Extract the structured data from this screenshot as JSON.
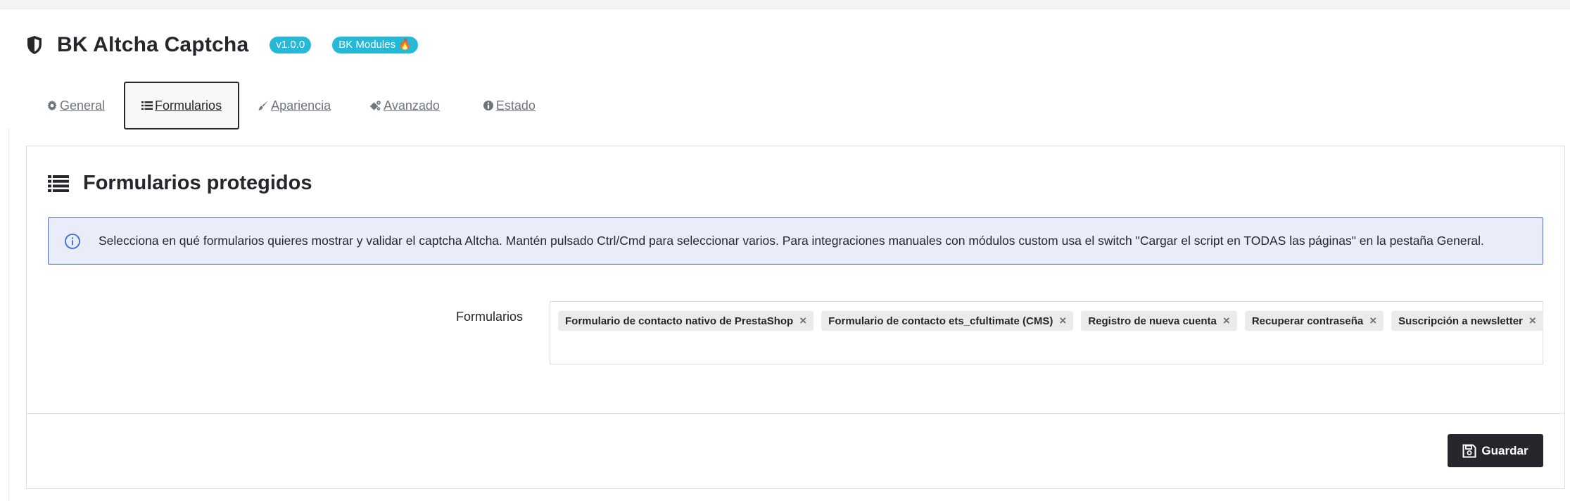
{
  "header": {
    "icon": "shield-icon",
    "title": "BK Altcha Captcha",
    "version_badge": "v1.0.0",
    "brand_badge": "BK Modules 🔥",
    "badge_color": "#25b9d7"
  },
  "tabs": [
    {
      "label": "General",
      "icon": "gear-icon",
      "active": false
    },
    {
      "label": "Formularios",
      "icon": "list-icon",
      "active": true
    },
    {
      "label": "Apariencia",
      "icon": "brush-icon",
      "active": false
    },
    {
      "label": "Avanzado",
      "icon": "gears-icon",
      "active": false
    },
    {
      "label": "Estado",
      "icon": "info-circle-icon",
      "active": false
    }
  ],
  "panel": {
    "title": "Formularios protegidos",
    "title_icon": "list-icon",
    "alert": {
      "icon": "info-icon",
      "text": "Selecciona en qué formularios quieres mostrar y validar el captcha Altcha. Mantén pulsado Ctrl/Cmd para seleccionar varios. Para integraciones manuales con módulos custom usa el switch \"Cargar el script en TODAS las páginas\" en la pestaña General.",
      "border_color": "#3c6bcb",
      "background": "#e8edf9"
    },
    "field": {
      "label": "Formularios",
      "selected": [
        "Formulario de contacto nativo de PrestaShop",
        "Formulario de contacto ets_cfultimate (CMS)",
        "Registro de nueva cuenta",
        "Recuperar contraseña",
        "Suscripción a newsletter"
      ],
      "remove_symbol": "×"
    },
    "save_button": {
      "label": "Guardar",
      "icon": "save-icon",
      "color": "#25272c"
    }
  }
}
